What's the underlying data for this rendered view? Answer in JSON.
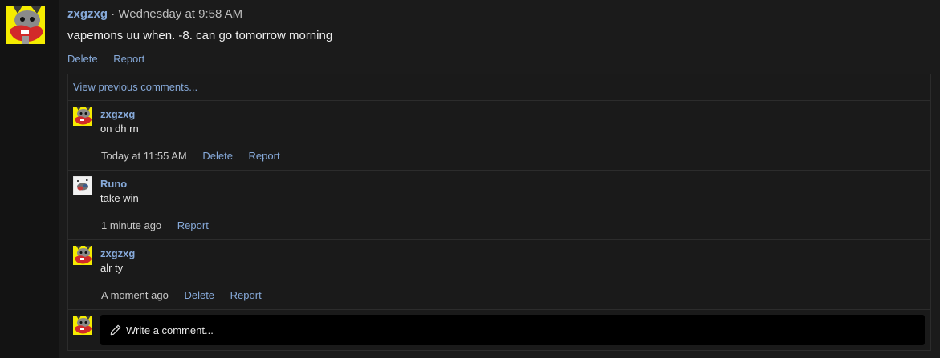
{
  "post": {
    "author": "zxgzxg",
    "separator": "·",
    "timestamp": "Wednesday at 9:58 AM",
    "body": "vapemons uu when. -8. can go tomorrow morning",
    "actions": {
      "delete": "Delete",
      "report": "Report"
    }
  },
  "comments": {
    "view_previous": "View previous comments...",
    "items": [
      {
        "author": "zxgzxg",
        "text": "on dh rn",
        "time": "Today at 11:55 AM",
        "delete": "Delete",
        "report": "Report"
      },
      {
        "author": "Runo",
        "text": "take win",
        "time": "1 minute ago",
        "report": "Report"
      },
      {
        "author": "zxgzxg",
        "text": "alr ty",
        "time": "A moment ago",
        "delete": "Delete",
        "report": "Report"
      }
    ],
    "write_placeholder": "Write a comment..."
  },
  "icons": {
    "avatar_zxgzxg": "cartoon-bird-avatar-icon",
    "avatar_runo": "runo-avatar-icon",
    "pencil": "pencil-icon"
  },
  "colors": {
    "link": "#86a9d9",
    "background": "#1b1b1b",
    "gutter": "#131313",
    "input_bg": "#000000",
    "avatar_yellow": "#f5ec00",
    "avatar_red": "#d22a2a"
  }
}
